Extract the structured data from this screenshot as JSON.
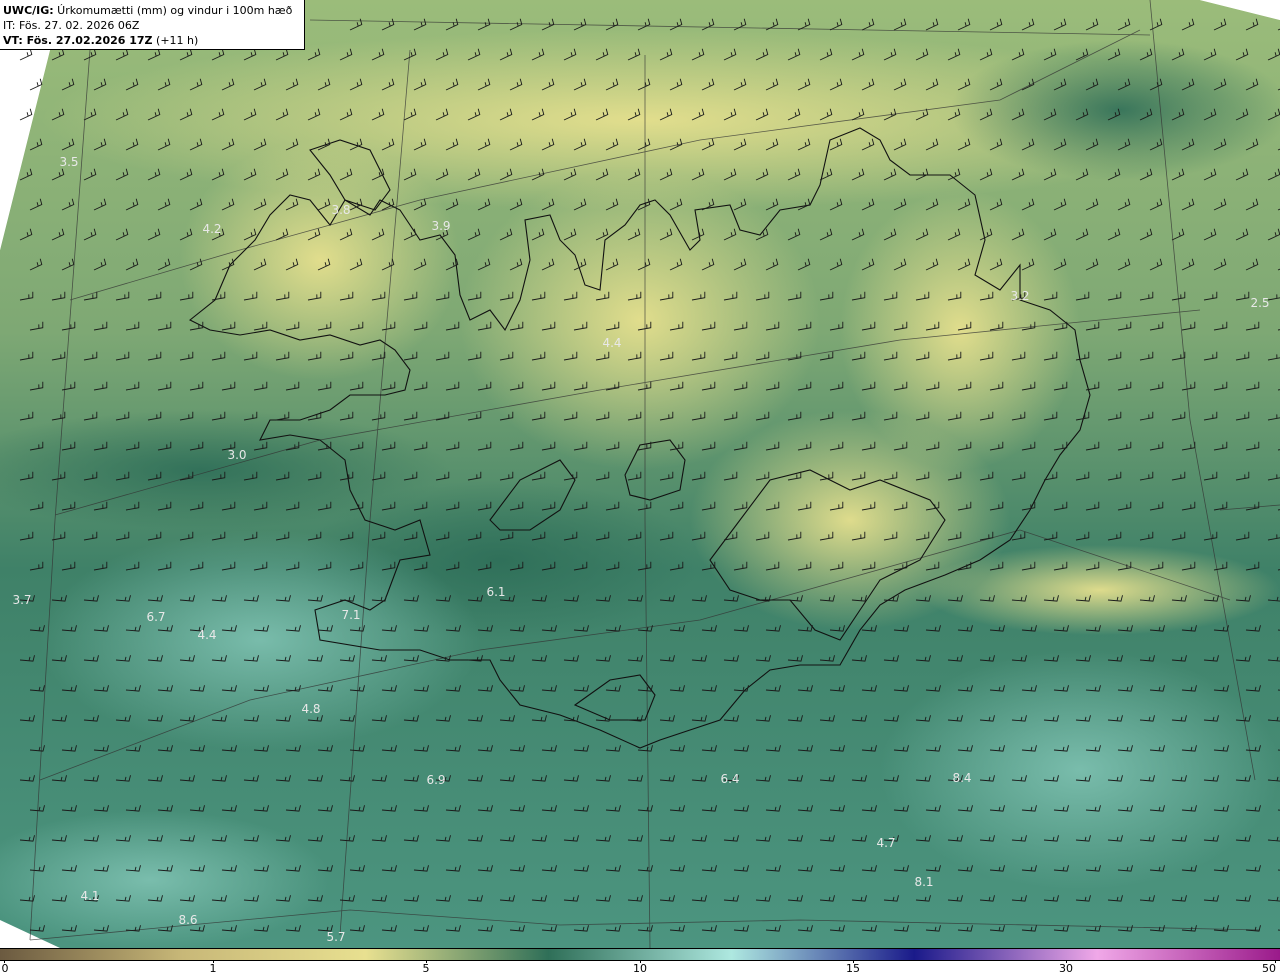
{
  "header": {
    "line1_bold": "UWC/IG:",
    "line1_text": " Úrkomumætti (mm) og vindur i 100m hæð",
    "line2": "IT: Fös. 27. 02. 2026 06Z",
    "line3_bold": "VT: Fös. 27.02.2026 17Z",
    "line3_text": " (+11 h)"
  },
  "point_values": [
    {
      "id": "pv-1",
      "value": "3.5"
    },
    {
      "id": "pv-2",
      "value": "4.2"
    },
    {
      "id": "pv-3",
      "value": "3.8"
    },
    {
      "id": "pv-4",
      "value": "3.9"
    },
    {
      "id": "pv-5",
      "value": "3.2"
    },
    {
      "id": "pv-6",
      "value": "2.5"
    },
    {
      "id": "pv-7",
      "value": "4.4"
    },
    {
      "id": "pv-8",
      "value": "3.0"
    },
    {
      "id": "pv-9",
      "value": "3.7"
    },
    {
      "id": "pv-10",
      "value": "6.7"
    },
    {
      "id": "pv-11",
      "value": "4.4"
    },
    {
      "id": "pv-12",
      "value": "7.1"
    },
    {
      "id": "pv-13",
      "value": "6.1"
    },
    {
      "id": "pv-14",
      "value": "4.8"
    },
    {
      "id": "pv-15",
      "value": "6.9"
    },
    {
      "id": "pv-16",
      "value": "6.4"
    },
    {
      "id": "pv-17",
      "value": "8.4"
    },
    {
      "id": "pv-18",
      "value": "4.7"
    },
    {
      "id": "pv-19",
      "value": "8.1"
    },
    {
      "id": "pv-20",
      "value": "4.1"
    },
    {
      "id": "pv-21",
      "value": "8.6"
    },
    {
      "id": "pv-22",
      "value": "5.7"
    }
  ],
  "colorbar": {
    "ticks": [
      "0",
      "1",
      "5",
      "10",
      "15",
      "30",
      "50"
    ],
    "colors": [
      "#6b5a40",
      "#c8b878",
      "#e8e090",
      "#2f6f58",
      "#aee8e0",
      "#1a1a8a",
      "#f0a8e8",
      "#9a1a8a"
    ]
  },
  "colors": {
    "land_light": "#d9d88a",
    "land_mid": "#8eb07a",
    "sea_dark": "#3d7e66",
    "sea_teal": "#5aa294",
    "coast": "#111111"
  }
}
